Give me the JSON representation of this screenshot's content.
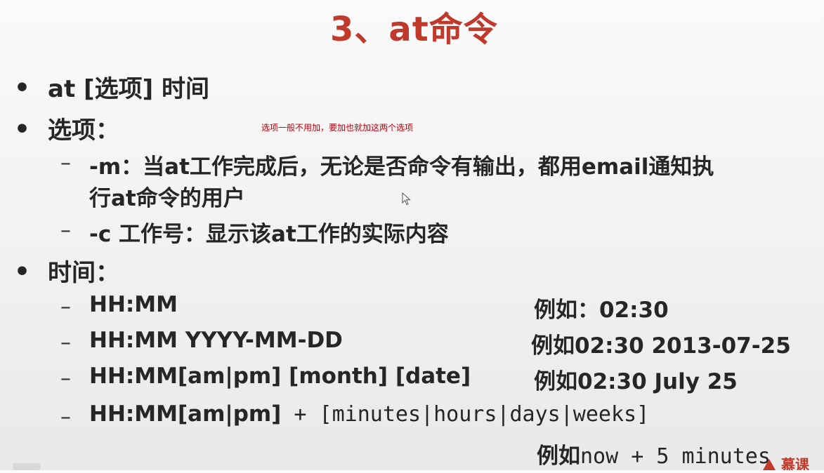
{
  "title": "3、at命令",
  "bullets": {
    "b1": "at [选项] 时间",
    "b2": "选项：",
    "b2_note": "选项一般不用加，要加也就加这两个选项",
    "opt_m_line1": "-m：当at工作完成后，无论是否命令有输出，都用email通知执",
    "opt_m_line2": "行at命令的用户",
    "opt_c": "-c 工作号：显示该at工作的实际内容",
    "b3": "时间："
  },
  "time_formats": [
    {
      "format": "HH:MM",
      "example": "例如：02:30"
    },
    {
      "format": "HH:MM YYYY-MM-DD",
      "example": "例如02:30 2013-07-25"
    },
    {
      "format": "HH:MM[am|pm] [month] [date]",
      "example": "例如02:30 July 25"
    }
  ],
  "relative": {
    "format_bold": "HH:MM[am|pm]",
    "format_mono": " + [minutes|hours|days|weeks]",
    "example_bold": "例如",
    "example_mono": "now + 5 minutes"
  },
  "bullet_char": "•",
  "dash_char": "–",
  "logo_text": "慕课",
  "colors": {
    "title": "#c0392b",
    "note": "#c0000e",
    "text": "#262626",
    "logo": "#c0392b"
  }
}
